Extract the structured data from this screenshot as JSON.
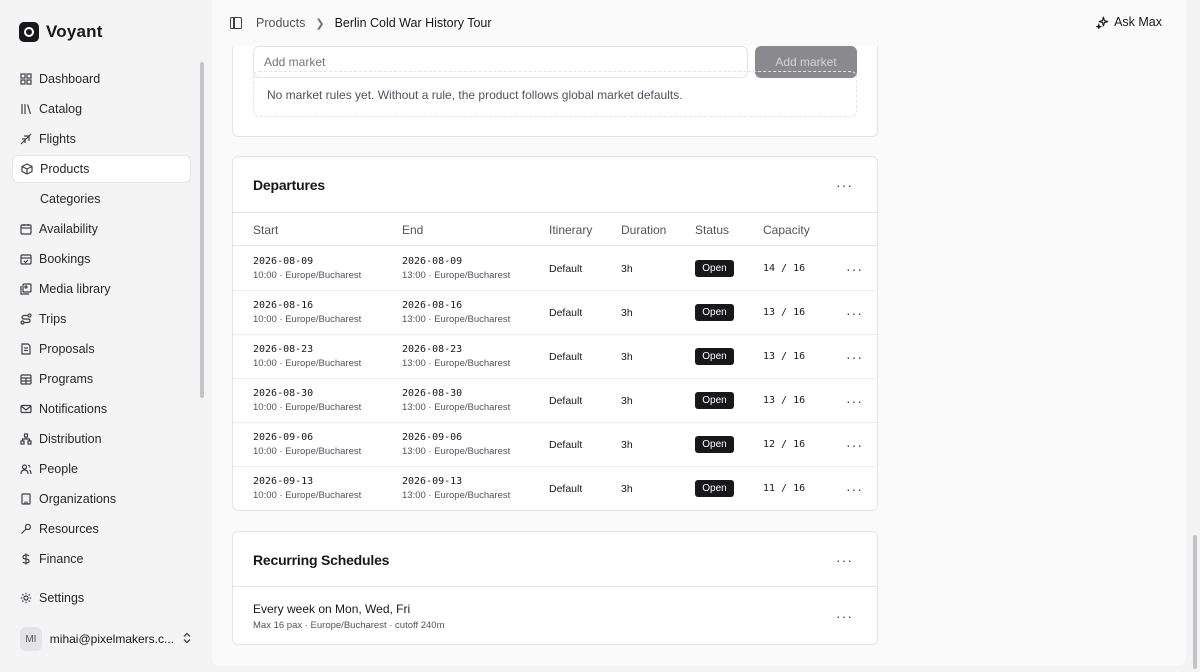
{
  "app": {
    "name": "Voyant"
  },
  "sidebar": {
    "items": [
      {
        "label": "Dashboard",
        "icon": "dashboard-icon"
      },
      {
        "label": "Catalog",
        "icon": "catalog-icon"
      },
      {
        "label": "Flights",
        "icon": "plane-icon"
      },
      {
        "label": "Products",
        "icon": "box-icon",
        "active": true
      },
      {
        "label": "Categories",
        "sub": true
      },
      {
        "label": "Availability",
        "icon": "calendar-icon"
      },
      {
        "label": "Bookings",
        "icon": "calendar-check-icon"
      },
      {
        "label": "Media library",
        "icon": "image-icon"
      },
      {
        "label": "Trips",
        "icon": "route-icon"
      },
      {
        "label": "Proposals",
        "icon": "file-icon"
      },
      {
        "label": "Programs",
        "icon": "calendar-grid-icon"
      },
      {
        "label": "Notifications",
        "icon": "mail-icon"
      },
      {
        "label": "Distribution",
        "icon": "network-icon"
      },
      {
        "label": "People",
        "icon": "users-icon"
      },
      {
        "label": "Organizations",
        "icon": "building-icon"
      },
      {
        "label": "Resources",
        "icon": "wrench-icon"
      },
      {
        "label": "Finance",
        "icon": "dollar-icon"
      }
    ],
    "settings_label": "Settings",
    "user": {
      "initials": "MI",
      "email": "mihai@pixelmakers.c..."
    }
  },
  "topbar": {
    "breadcrumb_parent": "Products",
    "breadcrumb_current": "Berlin Cold War History Tour",
    "ask_label": "Ask Max"
  },
  "markets": {
    "input_placeholder": "Add market",
    "add_button": "Add market",
    "empty_text": "No market rules yet. Without a rule, the product follows global market defaults."
  },
  "departures": {
    "title": "Departures",
    "columns": [
      "Start",
      "End",
      "Itinerary",
      "Duration",
      "Status",
      "Capacity"
    ],
    "rows": [
      {
        "start_date": "2026-08-09",
        "start_time": "10:00 · Europe/Bucharest",
        "end_date": "2026-08-09",
        "end_time": "13:00 · Europe/Bucharest",
        "itinerary": "Default",
        "duration": "3h",
        "status": "Open",
        "capacity": "14 / 16"
      },
      {
        "start_date": "2026-08-16",
        "start_time": "10:00 · Europe/Bucharest",
        "end_date": "2026-08-16",
        "end_time": "13:00 · Europe/Bucharest",
        "itinerary": "Default",
        "duration": "3h",
        "status": "Open",
        "capacity": "13 / 16"
      },
      {
        "start_date": "2026-08-23",
        "start_time": "10:00 · Europe/Bucharest",
        "end_date": "2026-08-23",
        "end_time": "13:00 · Europe/Bucharest",
        "itinerary": "Default",
        "duration": "3h",
        "status": "Open",
        "capacity": "13 / 16"
      },
      {
        "start_date": "2026-08-30",
        "start_time": "10:00 · Europe/Bucharest",
        "end_date": "2026-08-30",
        "end_time": "13:00 · Europe/Bucharest",
        "itinerary": "Default",
        "duration": "3h",
        "status": "Open",
        "capacity": "13 / 16"
      },
      {
        "start_date": "2026-09-06",
        "start_time": "10:00 · Europe/Bucharest",
        "end_date": "2026-09-06",
        "end_time": "13:00 · Europe/Bucharest",
        "itinerary": "Default",
        "duration": "3h",
        "status": "Open",
        "capacity": "12 / 16"
      },
      {
        "start_date": "2026-09-13",
        "start_time": "10:00 · Europe/Bucharest",
        "end_date": "2026-09-13",
        "end_time": "13:00 · Europe/Bucharest",
        "itinerary": "Default",
        "duration": "3h",
        "status": "Open",
        "capacity": "11 / 16"
      }
    ]
  },
  "recurring": {
    "title": "Recurring Schedules",
    "rule": "Every week on Mon, Wed, Fri",
    "details": "Max 16 pax · Europe/Bucharest · cutoff 240m"
  },
  "more_glyph": "···",
  "colors": {
    "status_open_bg": "#18181b",
    "accent": "#18181b",
    "sidebar_bg": "#f4f4f5"
  }
}
